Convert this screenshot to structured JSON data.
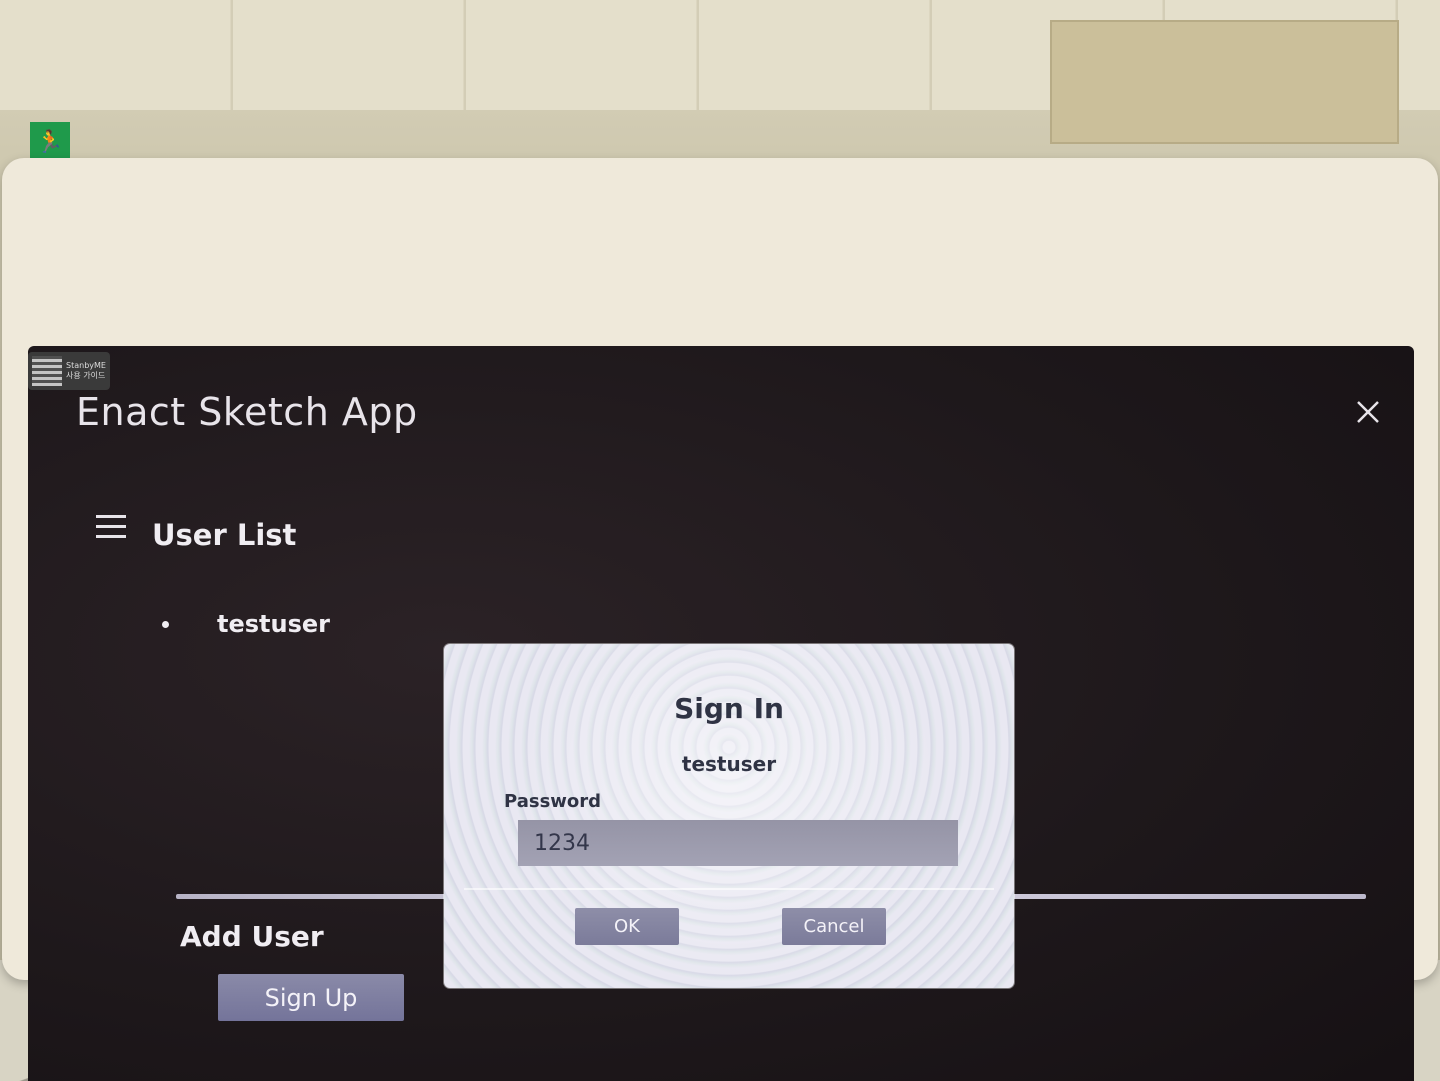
{
  "app": {
    "title": "Enact Sketch App",
    "qr_text_line1": "StanbyME",
    "qr_text_line2": "사용 가이드"
  },
  "icons": {
    "close": "close-icon",
    "menu": "hamburger-menu-icon",
    "qr": "qr-code-icon",
    "exit": "exit-sign-icon"
  },
  "user_list": {
    "heading": "User List",
    "users": [
      "testuser"
    ]
  },
  "add_user": {
    "heading": "Add User",
    "signup_label": "Sign Up"
  },
  "dialog": {
    "title": "Sign In",
    "username": "testuser",
    "password_label": "Password",
    "password_value": "1234",
    "ok_label": "OK",
    "cancel_label": "Cancel"
  },
  "colors": {
    "screen_bg": "#1e181b",
    "text_light": "#f0edf2",
    "button_bg": "#7b7b9a",
    "dialog_bg": "#e4e4ee",
    "dialog_text": "#2f3344"
  }
}
